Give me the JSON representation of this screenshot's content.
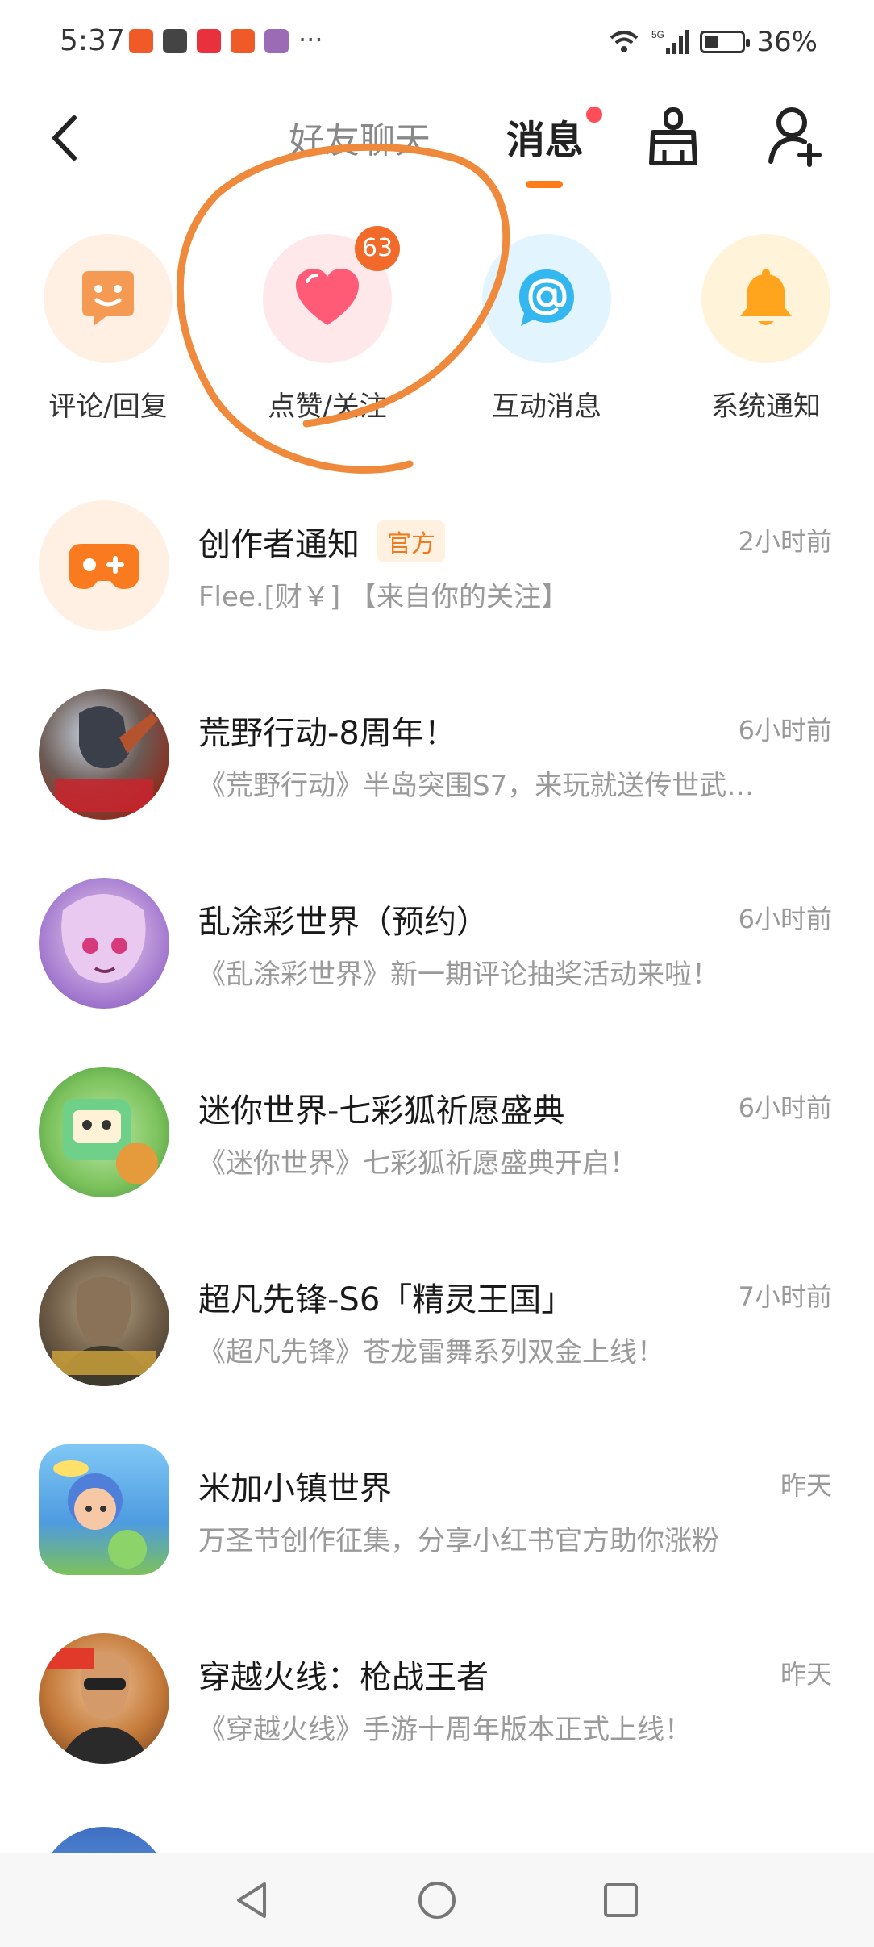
{
  "status_bar": {
    "time": "5:37",
    "battery": "36%",
    "battery_level": 0.36,
    "network": "5G"
  },
  "header": {
    "tab_friends": "好友聊天",
    "tab_messages": "消息"
  },
  "categories": [
    {
      "label": "评论/回复",
      "color": "#f59a52",
      "bg": "#fff0e3"
    },
    {
      "label": "点赞/关注",
      "color": "#ff5b76",
      "bg": "#ffe8ea",
      "badge": "63"
    },
    {
      "label": "互动消息",
      "color": "#34b7ef",
      "bg": "#e2f4fd"
    },
    {
      "label": "系统通知",
      "color": "#ffa41c",
      "bg": "#fff3da"
    }
  ],
  "messages": [
    {
      "title": "创作者通知",
      "tag": "官方",
      "time": "2小时前",
      "preview": "Flee.[财￥] 【来自你的关注】"
    },
    {
      "title": "荒野行动-8周年！",
      "time": "6小时前",
      "preview": "《荒野行动》半岛突围S7，来玩就送传世武…"
    },
    {
      "title": "乱涂彩世界（预约）",
      "time": "6小时前",
      "preview": "《乱涂彩世界》新一期评论抽奖活动来啦！"
    },
    {
      "title": "迷你世界-七彩狐祈愿盛典",
      "time": "6小时前",
      "preview": "《迷你世界》七彩狐祈愿盛典开启！"
    },
    {
      "title": "超凡先锋-S6「精灵王国」",
      "time": "7小时前",
      "preview": "《超凡先锋》苍龙雷舞系列双金上线！"
    },
    {
      "title": "米加小镇世界",
      "time": "昨天",
      "preview": "万圣节创作征集，分享小红书官方助你涨粉"
    },
    {
      "title": "穿越火线：枪战王者",
      "time": "昨天",
      "preview": "《穿越火线》手游十周年版本正式上线！"
    }
  ],
  "colors": {
    "accent": "#ff7a1a",
    "badge": "#f26a2a",
    "annotation": "#ef8a3c"
  }
}
